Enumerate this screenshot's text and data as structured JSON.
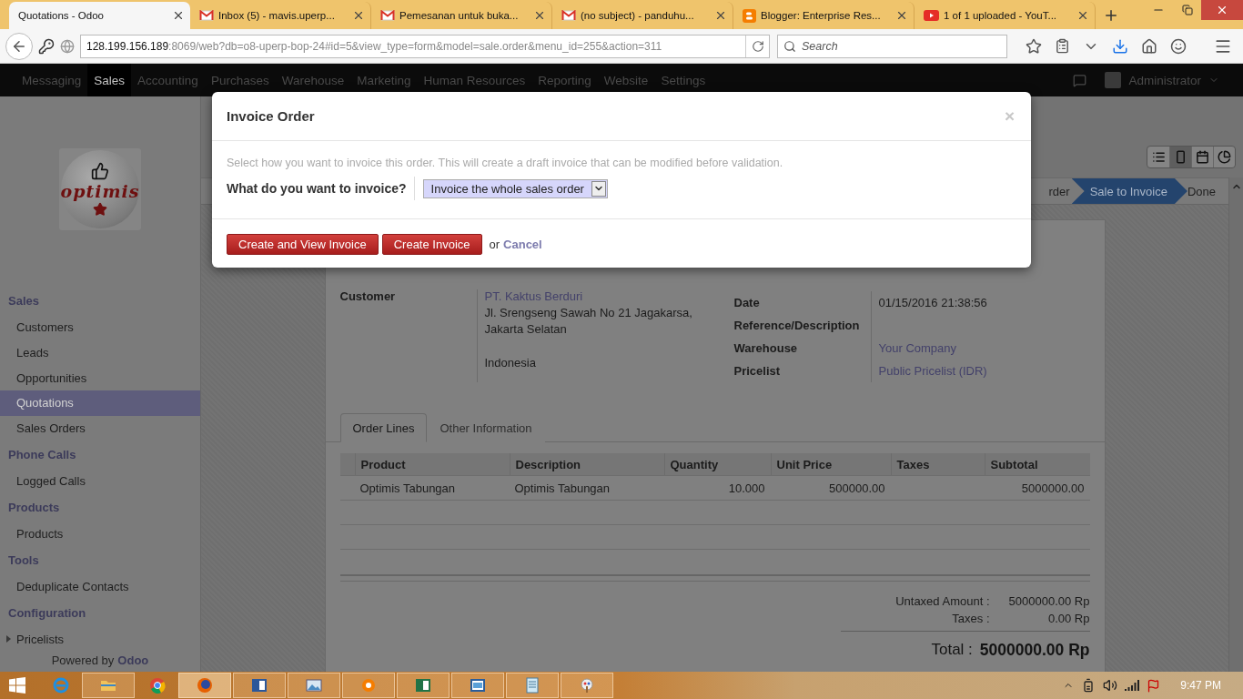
{
  "browser": {
    "tabs": [
      {
        "title": "Quotations - Odoo",
        "kind": "plain",
        "selected": true
      },
      {
        "title": "Inbox (5) - mavis.uperp...",
        "kind": "mail",
        "selected": false
      },
      {
        "title": "Pemesanan untuk buka...",
        "kind": "mail",
        "selected": false
      },
      {
        "title": "(no subject) - panduhu...",
        "kind": "mail",
        "selected": false
      },
      {
        "title": "Blogger: Enterprise Res...",
        "kind": "blogger",
        "selected": false
      },
      {
        "title": "1 of 1 uploaded - YouT...",
        "kind": "video",
        "selected": false
      }
    ],
    "address": {
      "host": "128.199.156.189",
      "path": ":8069/web?db=o8-uperp-bop-24#id=5&view_type=form&model=sale.order&menu_id=255&action=311"
    },
    "search": {
      "placeholder": "Search"
    }
  },
  "app": {
    "top_menu": [
      {
        "label": "Messaging",
        "selected": false
      },
      {
        "label": "Sales",
        "selected": true
      },
      {
        "label": "Accounting",
        "selected": false
      },
      {
        "label": "Purchases",
        "selected": false
      },
      {
        "label": "Warehouse",
        "selected": false
      },
      {
        "label": "Marketing",
        "selected": false
      },
      {
        "label": "Human Resources",
        "selected": false
      },
      {
        "label": "Reporting",
        "selected": false
      },
      {
        "label": "Website",
        "selected": false
      },
      {
        "label": "Settings",
        "selected": false
      }
    ],
    "user": "Administrator",
    "sidebar": {
      "logo_text": "optimis",
      "sections": [
        {
          "title": "Sales",
          "items": [
            {
              "label": "Customers",
              "selected": false
            },
            {
              "label": "Leads",
              "selected": false
            },
            {
              "label": "Opportunities",
              "selected": false
            },
            {
              "label": "Quotations",
              "selected": true
            },
            {
              "label": "Sales Orders",
              "selected": false
            }
          ]
        },
        {
          "title": "Phone Calls",
          "items": [
            {
              "label": "Logged Calls",
              "selected": false
            }
          ]
        },
        {
          "title": "Products",
          "items": [
            {
              "label": "Products",
              "selected": false
            }
          ]
        },
        {
          "title": "Tools",
          "items": [
            {
              "label": "Deduplicate Contacts",
              "selected": false
            }
          ]
        },
        {
          "title": "Configuration",
          "items": [
            {
              "label": "Pricelists",
              "selected": false,
              "kind": "group",
              "expanded": false
            }
          ]
        }
      ],
      "powered_by": {
        "text": "Powered by",
        "brand": "Odoo"
      }
    },
    "view_switcher": [
      {
        "kind": "list",
        "selected": false
      },
      {
        "kind": "form",
        "selected": true
      },
      {
        "kind": "calendar",
        "selected": false
      },
      {
        "kind": "graph",
        "selected": false
      }
    ],
    "stages": [
      {
        "label": "rder",
        "selected": false
      },
      {
        "label": "Sale to Invoice",
        "selected": true
      },
      {
        "label": "Done",
        "selected": false
      }
    ],
    "form": {
      "customer": {
        "label": "Customer",
        "name": "PT. Kaktus Berduri",
        "street": "Jl. Srengseng Sawah No 21 Jagakarsa,",
        "city": "Jakarta Selatan",
        "country": "Indonesia"
      },
      "info": [
        {
          "label": "Date",
          "value": "01/15/2016 21:38:56",
          "kind": "text"
        },
        {
          "label": "Reference/Description"
        },
        {
          "label": "Warehouse",
          "value": "Your Company",
          "kind": "link"
        },
        {
          "label": "Pricelist",
          "value": "Public Pricelist (IDR)",
          "kind": "link"
        }
      ],
      "tabs": [
        {
          "label": "Order Lines",
          "selected": true
        },
        {
          "label": "Other Information",
          "selected": false
        }
      ],
      "table": {
        "columns": [
          "Product",
          "Description",
          "Quantity",
          "Unit Price",
          "Taxes",
          "Subtotal"
        ],
        "rows": [
          {
            "product": "Optimis Tabungan",
            "description": "Optimis Tabungan",
            "quantity": "10.000",
            "unit_price": "500000.00",
            "subtotal": "5000000.00"
          }
        ]
      },
      "totals": [
        {
          "label": "Untaxed Amount :",
          "value": "5000000.00 Rp"
        },
        {
          "label": "Taxes :",
          "value": "0.00 Rp"
        }
      ],
      "total": {
        "label": "Total :",
        "value": "5000000.00 Rp"
      }
    }
  },
  "modal": {
    "title": "Invoice Order",
    "close": "×",
    "description": "Select how you want to invoice this order. This will create a draft invoice that can be modified before validation.",
    "question": "What do you want to invoice?",
    "choice": "Invoice the whole sales order",
    "buttons": [
      "Create and View Invoice",
      "Create Invoice"
    ],
    "or": "or",
    "cancel": "Cancel"
  },
  "taskbar": {
    "apps": [
      {
        "kind": "ie",
        "open": false,
        "selected": false
      },
      {
        "kind": "folder",
        "open": true,
        "selected": false
      },
      {
        "kind": "chrome",
        "open": false,
        "selected": false
      },
      {
        "kind": "firefox",
        "open": true,
        "selected": true
      },
      {
        "kind": "word",
        "open": true,
        "selected": false
      },
      {
        "kind": "photos",
        "open": true,
        "selected": false
      },
      {
        "kind": "blogger",
        "open": true,
        "selected": false
      },
      {
        "kind": "excel",
        "open": true,
        "selected": false
      },
      {
        "kind": "viewer",
        "open": true,
        "selected": false
      },
      {
        "kind": "notepad",
        "open": true,
        "selected": false
      },
      {
        "kind": "paint",
        "open": true,
        "selected": false
      }
    ],
    "time": "9:47 PM"
  }
}
